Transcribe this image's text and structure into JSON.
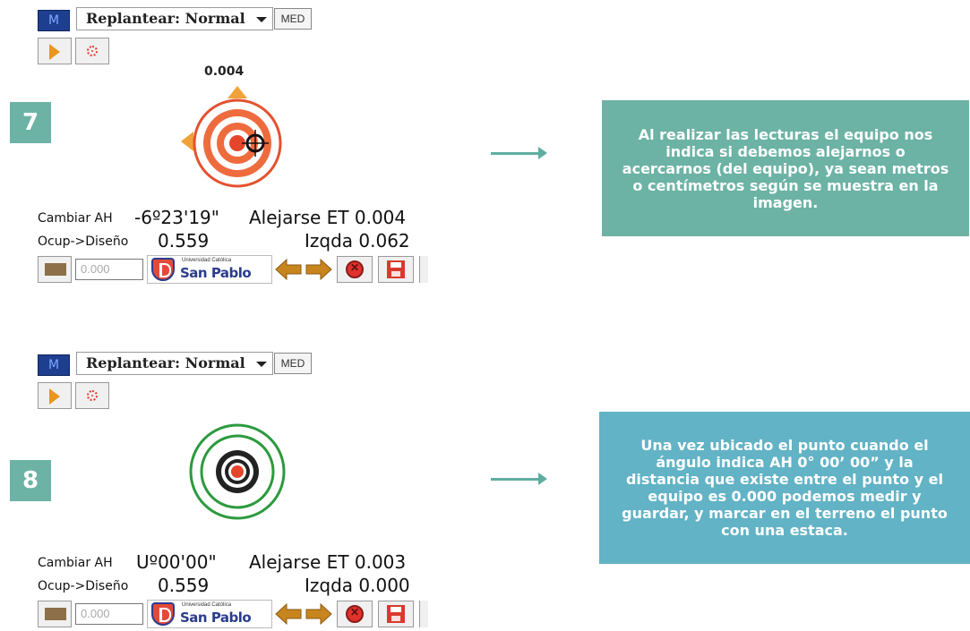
{
  "screens": [
    {
      "step": "7",
      "toolbar": {
        "m_label": "M",
        "mode_label": "Replantear: Normal",
        "med_label": "MED"
      },
      "distance_label": "0.004",
      "readouts": {
        "row1_label": "Cambiar AH",
        "row1_angle": "-6º23'19\"",
        "row1_right": "Alejarse ET 0.004",
        "row2_label": "Ocup->Diseño",
        "row2_value": "0.559",
        "row2_right": "Izqda 0.062"
      },
      "bottom": {
        "input_value": "0.000",
        "logo_small": "Universidad Católica",
        "logo_big": "San Pablo"
      },
      "target_style": "red-with-arrows"
    },
    {
      "step": "8",
      "toolbar": {
        "m_label": "M",
        "mode_label": "Replantear: Normal",
        "med_label": "MED"
      },
      "distance_label": "",
      "readouts": {
        "row1_label": "Cambiar AH",
        "row1_angle": "Uº00'00\"",
        "row1_right": "Alejarse ET 0.003",
        "row2_label": "Ocup->Diseño",
        "row2_value": "0.559",
        "row2_right": "Izqda 0.000"
      },
      "bottom": {
        "input_value": "0.000",
        "logo_small": "Universidad Católica",
        "logo_big": "San Pablo"
      },
      "target_style": "green-centered"
    }
  ],
  "info_boxes": [
    {
      "text": "Al realizar las lecturas el equipo nos indica si debemos alejarnos o acercarnos (del equipo), ya sean metros o centímetros según se muestra en la imagen.",
      "color": "#6cb3a5"
    },
    {
      "text": "Una vez ubicado el punto cuando el ángulo indica AH 0° 00’ 00” y la distancia que existe entre el punto y el equipo es 0.000 podemos medir y guardar, y marcar en el terreno el punto con una estaca.",
      "color": "#62b3c5"
    }
  ],
  "icons": {
    "play": "play-icon",
    "target": "target-icon",
    "stop": "stop-icon",
    "save": "save-icon",
    "flag": "flag-icon",
    "arrow_left": "arrow-left-icon",
    "arrow_right": "arrow-right-icon"
  }
}
